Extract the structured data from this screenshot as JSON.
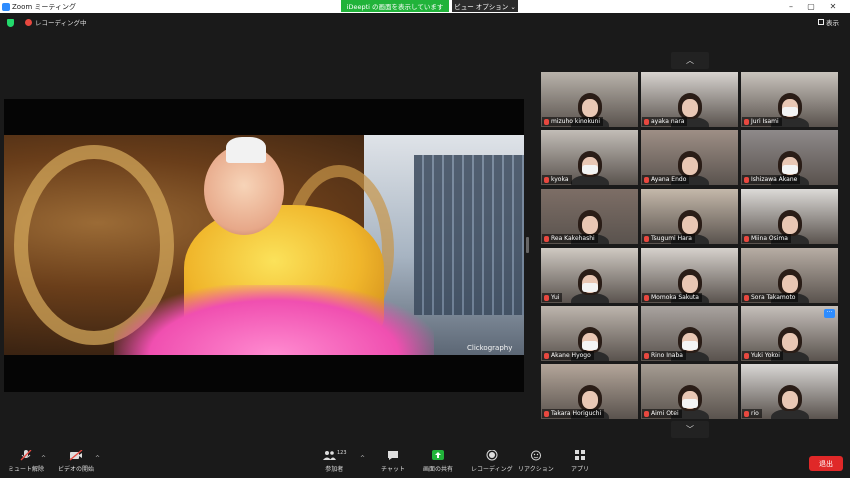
{
  "window": {
    "title": "Zoom ミーティング",
    "share_banner": "iDeepti の画面を表示しています",
    "view_options": "ビュー オプション ⌄",
    "controls": [
      "–",
      "▢",
      "✕"
    ]
  },
  "header": {
    "recording_label": "レコーディング中",
    "view_label": "表示"
  },
  "shared_screen": {
    "watermark": "Clickography"
  },
  "gallery": {
    "up_arrow": "︿",
    "down_arrow": "﹀",
    "participants": [
      {
        "name": "mizuho kinokuni",
        "masked": false,
        "bg": "#b9b3ab"
      },
      {
        "name": "ayaka nara",
        "masked": false,
        "bg": "#d7d3cf"
      },
      {
        "name": "Juri Isami",
        "masked": true,
        "bg": "#c9c4bd"
      },
      {
        "name": "kyoka",
        "masked": true,
        "bg": "#c2bdb7"
      },
      {
        "name": "Ayana Endo",
        "masked": false,
        "bg": "#9e8f86"
      },
      {
        "name": "Ishizawa Akane",
        "masked": true,
        "bg": "#8e8a8a"
      },
      {
        "name": "Rea Kakehashi",
        "masked": false,
        "bg": "#7d6e66"
      },
      {
        "name": "Tsugumi Hara",
        "masked": false,
        "bg": "#c4b8aa"
      },
      {
        "name": "Miina Osima",
        "masked": false,
        "bg": "#dcdad7"
      },
      {
        "name": "Yui",
        "masked": true,
        "bg": "#cfc9c2"
      },
      {
        "name": "Momoka Sakuta",
        "masked": false,
        "bg": "#d6d1cc"
      },
      {
        "name": "Sora Takamoto",
        "masked": false,
        "bg": "#b7ada4"
      },
      {
        "name": "Akane Hyogo",
        "masked": true,
        "bg": "#bdb5ad"
      },
      {
        "name": "Rino Inaba",
        "masked": true,
        "bg": "#a9a39f"
      },
      {
        "name": "Yuki Yokoi",
        "masked": false,
        "bg": "#c5bfba"
      },
      {
        "name": "Takara Horiguchi",
        "masked": false,
        "bg": "#b4a69a"
      },
      {
        "name": "Aimi Otei",
        "masked": true,
        "bg": "#a59c92"
      },
      {
        "name": "rio",
        "masked": false,
        "bg": "#d9d7d5"
      }
    ],
    "more_button": "···"
  },
  "toolbar": {
    "mute": "ミュート解除",
    "video": "ビデオの開始",
    "participants": "参加者",
    "participant_count": "123",
    "chat": "チャット",
    "share": "画面の共有",
    "record": "レコーディング",
    "reactions": "リアクション",
    "apps": "アプリ",
    "leave": "退出"
  },
  "colors": {
    "share_green": "#21b33a",
    "leave_red": "#e02828",
    "mic_off_red": "#e8483f",
    "accent_blue": "#2d8cff"
  }
}
